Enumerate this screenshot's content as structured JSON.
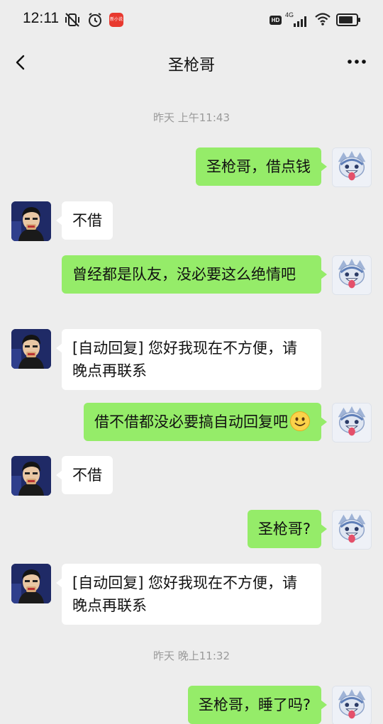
{
  "status_bar": {
    "time": "12:11",
    "app_badge": "新小说",
    "hd": "HD",
    "network": "4G"
  },
  "nav": {
    "title": "圣枪哥",
    "back_icon": "chevron-left-icon",
    "more_icon": "more-horizontal-icon"
  },
  "timestamps": [
    "昨天 上午11:43",
    "昨天 晚上11:32"
  ],
  "messages": [
    {
      "sender": "me",
      "text": "圣枪哥，借点钱"
    },
    {
      "sender": "friend",
      "text": "不借"
    },
    {
      "sender": "me",
      "text": "曾经都是队友，没必要这么绝情吧"
    },
    {
      "sender": "friend",
      "text": "[自动回复] 您好我现在不方便，请晚点再联系"
    },
    {
      "sender": "me",
      "text": "借不借都没必要搞自动回复吧",
      "emoji": "smile-emoji"
    },
    {
      "sender": "friend",
      "text": "不借"
    },
    {
      "sender": "me",
      "text": "圣枪哥?"
    },
    {
      "sender": "friend",
      "text": "[自动回复] 您好我现在不方便，请晚点再联系"
    },
    {
      "sender": "me",
      "text": "圣枪哥，睡了吗?"
    }
  ],
  "colors": {
    "background": "#ededed",
    "my_bubble": "#95ec69",
    "friend_bubble": "#ffffff",
    "timestamp_text": "#9a9a9a"
  }
}
